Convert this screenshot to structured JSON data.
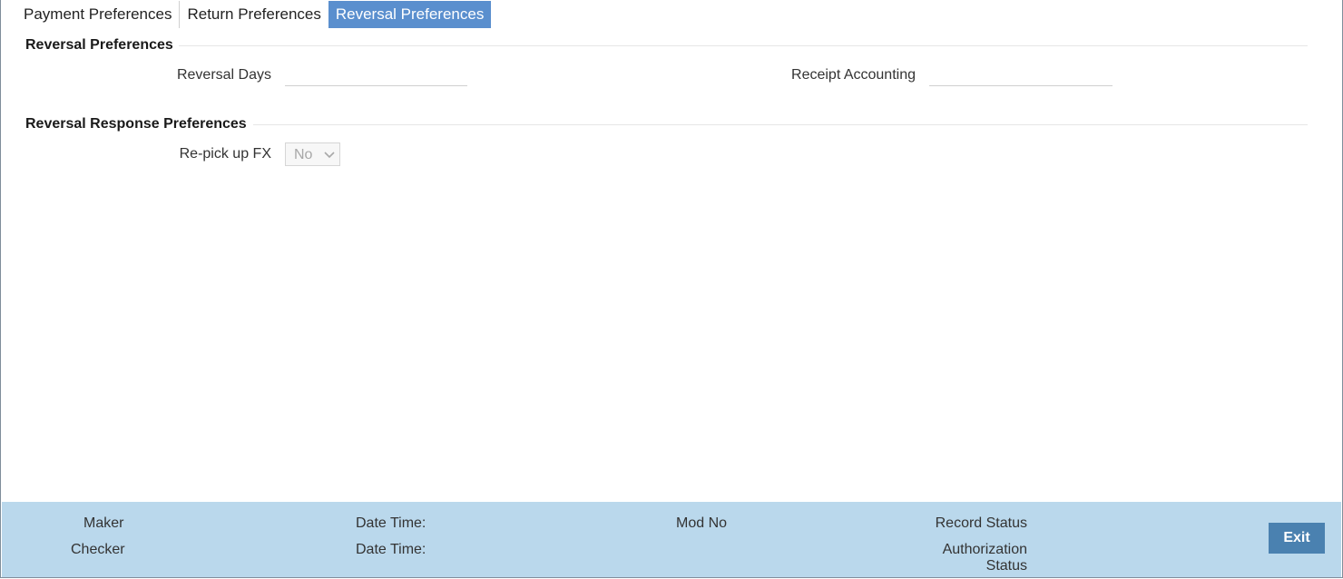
{
  "tabs": [
    {
      "label": "Payment Preferences",
      "active": false
    },
    {
      "label": "Return Preferences",
      "active": false
    },
    {
      "label": "Reversal Preferences",
      "active": true
    }
  ],
  "sections": {
    "reversal": {
      "title": "Reversal Preferences",
      "reversal_days": {
        "label": "Reversal Days",
        "value": ""
      },
      "receipt_accounting": {
        "label": "Receipt Accounting",
        "value": ""
      }
    },
    "response": {
      "title": "Reversal Response Preferences",
      "repick_fx": {
        "label": "Re-pick up FX",
        "selected": "No",
        "icon": "chevron-down-icon"
      }
    }
  },
  "footer": {
    "maker": "Maker",
    "checker": "Checker",
    "date_time_1": "Date Time:",
    "date_time_2": "Date Time:",
    "mod_no": "Mod No",
    "record_status": "Record Status",
    "authorization_status_line1": "Authorization",
    "authorization_status_line2": "Status",
    "exit_label": "Exit"
  },
  "colors": {
    "active_tab": "#5a8fce",
    "footer_bg": "#bad8ec",
    "exit_button": "#4a81b0"
  }
}
